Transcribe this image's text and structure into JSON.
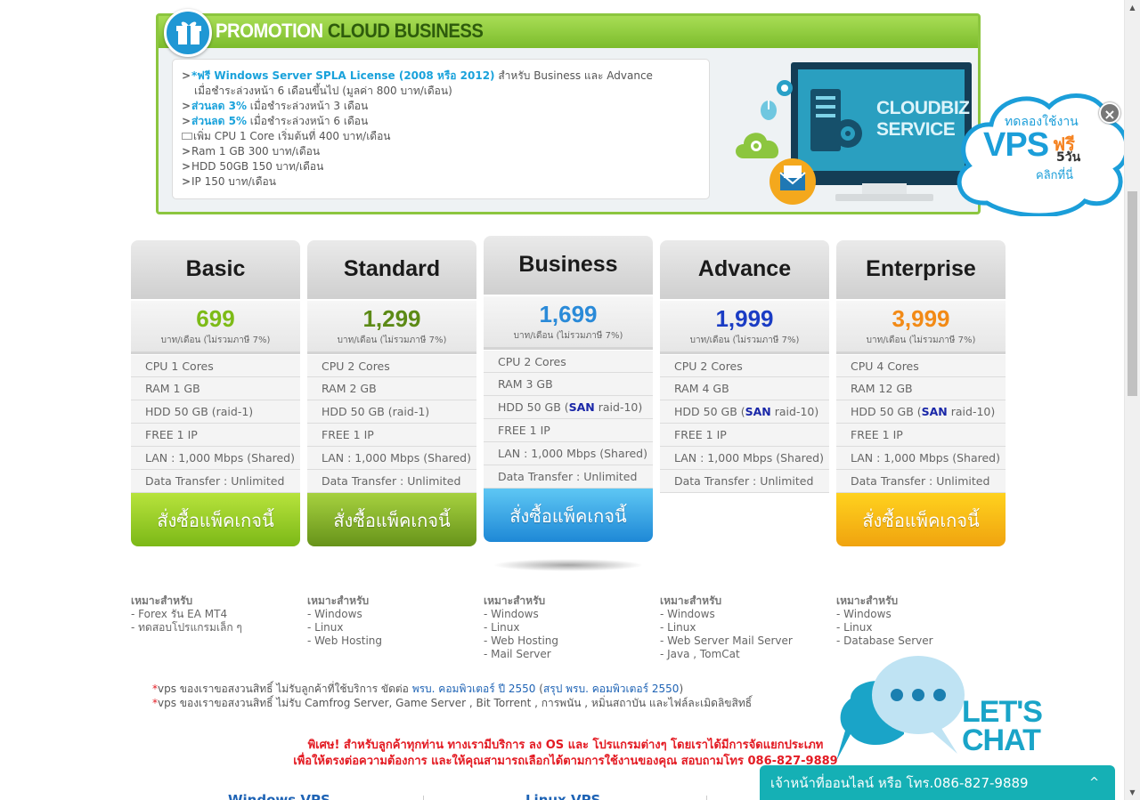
{
  "promo": {
    "title_a": "PROMOTION",
    "title_b": "CLOUD BUSINESS",
    "lines": [
      {
        "arrow": ">",
        "hl": "*ฟรี Windows Server SPLA License (2008 หรือ 2012)",
        "text": " สำหรับ Business และ Advance"
      },
      {
        "arrow": "",
        "hl": "",
        "text": "เมื่อชำระล่วงหน้า 6  เดือนขึ้นไป (มูลค่า 800 บาท/เดือน)"
      },
      {
        "arrow": ">",
        "hl": "ส่วนลด 3%",
        "text": " เมื่อชำระล่วงหน้า 3 เดือน"
      },
      {
        "arrow": ">",
        "hl": "ส่วนลด 5%",
        "text": " เมื่อชำระล่วงหน้า 6 เดือน"
      },
      {
        "arrow": "",
        "hl": "",
        "text": "เพิ่ม CPU 1 Core เริ่มต้นที่ 400 บาท/เดือน"
      },
      {
        "arrow": ">",
        "hl": "",
        "text": "Ram 1 GB 300 บาท/เดือน"
      },
      {
        "arrow": ">",
        "hl": "",
        "text": "HDD 50GB 150 บาท/เดือน"
      },
      {
        "arrow": ">",
        "hl": "",
        "text": "IP 150 บาท/เดือน"
      }
    ],
    "service_line1": "CLOUDBIZ",
    "service_line2": "SERVICE"
  },
  "vps_badge": {
    "try": "ทดลองใช้งาน",
    "vps": "VPS",
    "free": "ฟรี",
    "days": "5วัน",
    "click": "คลิกที่นี่",
    "close": "×"
  },
  "plans": [
    {
      "name": "Basic",
      "price": "699",
      "unit": "บาท/เดือน (ไม่รวมภาษี 7%)",
      "color": "#7dbb17",
      "specs": [
        "CPU 1 Cores",
        "RAM 1 GB",
        "HDD 50 GB (raid-1)",
        "FREE 1 IP",
        "LAN : 1,000 Mbps (Shared)",
        "Data Transfer : Unlimited"
      ],
      "button": "สั่งซื้อแพ็คเกจนี้",
      "suitable_title": "เหมาะสำหรับ",
      "suitable": [
        "- Forex รัน EA MT4",
        "- ทดสอบโปรแกรมเล็ก ๆ"
      ]
    },
    {
      "name": "Standard",
      "price": "1,299",
      "unit": "บาท/เดือน (ไม่รวมภาษี 7%)",
      "color": "#5c8a16",
      "specs": [
        "CPU 2 Cores",
        "RAM 2 GB",
        "HDD 50 GB (raid-1)",
        "FREE 1 IP",
        "LAN : 1,000 Mbps (Shared)",
        "Data Transfer : Unlimited"
      ],
      "button": "สั่งซื้อแพ็คเกจนี้",
      "suitable_title": "เหมาะสำหรับ",
      "suitable": [
        "- Windows",
        "- Linux",
        "- Web Hosting"
      ]
    },
    {
      "name": "Business",
      "price": "1,699",
      "unit": "บาท/เดือน (ไม่รวมภาษี 7%)",
      "color": "#2a8ad8",
      "specs": [
        "CPU 2 Cores",
        "RAM 3 GB",
        "HDD 50 GB (SAN raid-10)",
        "FREE 1 IP",
        "LAN : 1,000 Mbps (Shared)",
        "Data Transfer : Unlimited"
      ],
      "button": "สั่งซื้อแพ็คเกจนี้",
      "suitable_title": "เหมาะสำหรับ",
      "suitable": [
        "- Windows",
        "- Linux",
        "- Web Hosting",
        "- Mail Server"
      ]
    },
    {
      "name": "Advance",
      "price": "1,999",
      "unit": "บาท/เดือน (ไม่รวมภาษี 7%)",
      "color": "#1a3cc4",
      "specs": [
        "CPU 2 Cores",
        "RAM 4 GB",
        "HDD 50 GB (SAN raid-10)",
        "FREE 1 IP",
        "LAN : 1,000 Mbps (Shared)",
        "Data Transfer : Unlimited"
      ],
      "button": "",
      "suitable_title": "เหมาะสำหรับ",
      "suitable": [
        "- Windows",
        "- Linux",
        "- Web Server Mail Server",
        "- Java , TomCat"
      ]
    },
    {
      "name": "Enterprise",
      "price": "3,999",
      "unit": "บาท/เดือน (ไม่รวมภาษี 7%)",
      "color": "#f28a16",
      "specs": [
        "CPU 4 Cores",
        "RAM 12 GB",
        "HDD 50 GB (SAN raid-10)",
        "FREE 1 IP",
        "LAN : 1,000 Mbps (Shared)",
        "Data Transfer : Unlimited"
      ],
      "button": "สั่งซื้อแพ็คเกจนี้",
      "suitable_title": "เหมาะสำหรับ",
      "suitable": [
        "- Windows",
        "- Linux",
        "- Database Server"
      ]
    }
  ],
  "notes": {
    "note1_a": "vps ของเราขอสงวนสิทธิ์ ไม่รับลูกค้าที่ใช้บริการ ขัดต่อ ",
    "note1_link1": "พรบ. คอมพิวเตอร์ ปี 2550",
    "note1_b": " (",
    "note1_link2": "สรุป พรบ. คอมพิวเตอร์ 2550",
    "note1_c": ")",
    "note2": "vps ของเราขอสงวนสิทธิ์ ไม่รับ Camfrog Server, Game Server , Bit Torrent , การพนัน , หมิ่นสถาบัน และไฟล์ละเมิดลิขสิทธิ์",
    "special1": "พิเศษ! สำหรับลูกค้าทุกท่าน ทางเรามีบริการ ลง OS และ โปรแกรมต่างๆ โดยเราได้มีการจัดแยกประเภท",
    "special2": "เพื่อให้ตรงต่อความต้องการ และให้คุณสามารถเลือกได้ตามการใช้งานของคุณ สอบถามโทร 086-827-9889"
  },
  "tabs": [
    "Windows VPS",
    "Linux VPS"
  ],
  "chat": {
    "headline1": "LET'S",
    "headline2": "CHAT",
    "bar_text": "เจ้าหน้าที่ออนไลน์ หรือ โทร.086-827-9889",
    "chevron": "^"
  }
}
